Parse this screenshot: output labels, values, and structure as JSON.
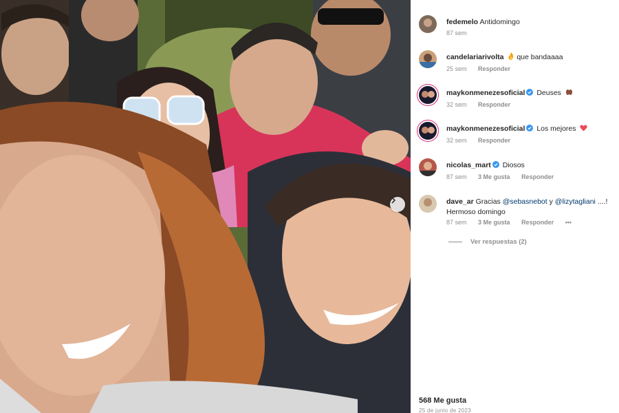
{
  "post": {
    "next_icon": "chevron-right-icon",
    "likes_label": "568 Me gusta",
    "date": "25 de junio de 2023"
  },
  "comments": [
    {
      "user": "fedemelo",
      "text": "Antidomingo",
      "time": "87 sem",
      "verified": false
    },
    {
      "user": "candelariarivolta",
      "text": " que bandaaaa",
      "emoji": "fire-icon",
      "time": "25 sem",
      "reply": "Responder",
      "verified": false
    },
    {
      "user": "maykonmenezesoficial",
      "text": " Deuses",
      "emoji": "hands-icon",
      "time": "32 sem",
      "reply": "Responder",
      "verified": true
    },
    {
      "user": "maykonmenezesoficial",
      "text": " Los mejores",
      "emoji": "heart-icon",
      "time": "32 sem",
      "reply": "Responder",
      "verified": true
    },
    {
      "user": "nicolas_mart",
      "text": " Diosos",
      "time": "87 sem",
      "likes": "3 Me gusta",
      "reply": "Responder",
      "verified": true
    },
    {
      "user": "dave_ar",
      "text_pre": " Gracias ",
      "mention1": "@sebasnebot",
      "text_mid": " y ",
      "mention2": "@lizytagliani",
      "text_post": " ....! Hermoso domingo",
      "time": "87 sem",
      "likes": "3 Me gusta",
      "reply": "Responder",
      "more": "•••",
      "verified": false
    }
  ],
  "view_replies": "Ver respuestas (2)",
  "colors": {
    "verified": "#3897f0",
    "heart": "#ed4956",
    "ring": "#d62976"
  }
}
